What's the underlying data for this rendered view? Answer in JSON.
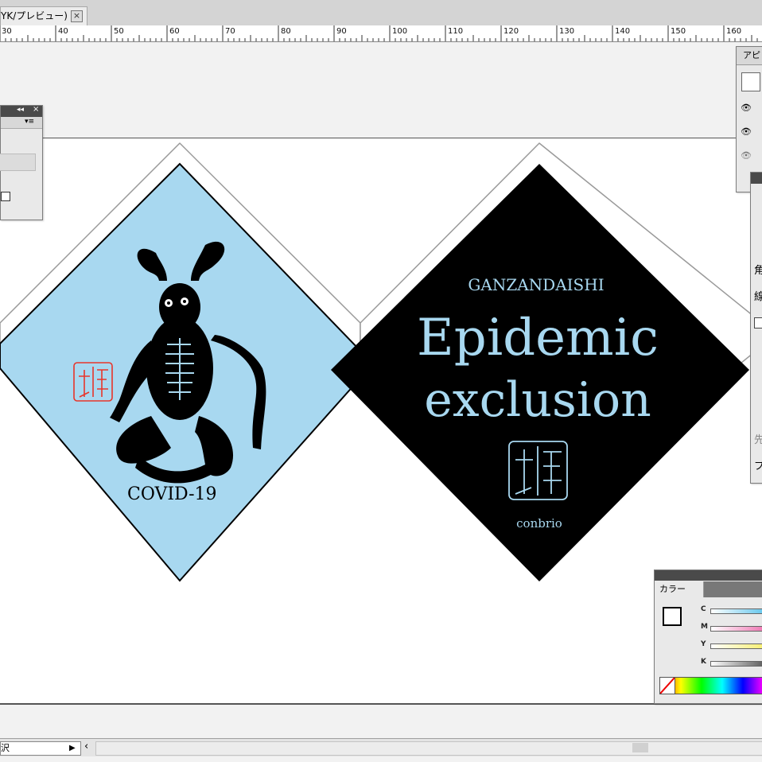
{
  "document_tab": {
    "title": "YK/プレビュー)",
    "close_icon": "close-icon"
  },
  "ruler": {
    "labels": [
      "30",
      "40",
      "50",
      "60",
      "70",
      "80",
      "90",
      "100",
      "110",
      "120",
      "130",
      "140",
      "150",
      "160"
    ]
  },
  "artwork": {
    "left_caption": "COVID-19",
    "right_heading": "GANZANDAISHI",
    "right_title_line1": "Epidemic",
    "right_title_line2": "exclusion",
    "right_footer": "conbrio",
    "colors": {
      "light_blue": "#a8d8f0",
      "black": "#000000",
      "title_blue": "#a8d8f0",
      "seal_red": "#e8352a"
    }
  },
  "panels": {
    "appearance_tab": "アピ",
    "stroke_label_1": "角",
    "stroke_label_2": "線",
    "stroke_label_3": "先",
    "stroke_label_4": "プ",
    "color_panel": {
      "title": "カラー",
      "channels": [
        "C",
        "M",
        "Y",
        "K"
      ]
    }
  },
  "status_bar": {
    "label": "沢",
    "nav_arrow_icon": "play-icon",
    "scroll_left_icon": "chevron-left-icon"
  }
}
